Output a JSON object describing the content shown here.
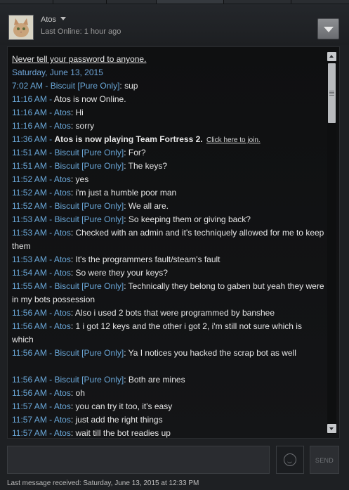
{
  "header": {
    "friend_name": "Atos",
    "last_online": "Last Online: 1 hour ago"
  },
  "chat": {
    "warning": "Never tell your password to anyone.",
    "date": "Saturday, June 13, 2015",
    "messages": [
      {
        "ts": "7:02 AM",
        "sender": "Biscuit [Pure Only]",
        "text": "sup"
      },
      {
        "ts": "11:16 AM",
        "sender": "",
        "text": "Atos is now Online."
      },
      {
        "ts": "11:16 AM",
        "sender": "Atos",
        "text": "Hi"
      },
      {
        "ts": "11:16 AM",
        "sender": "Atos",
        "text": "sorry"
      },
      {
        "ts": "11:36 AM",
        "sender": "",
        "text": "Atos is now playing Team Fortress 2.",
        "link": "Click here to join."
      },
      {
        "ts": "11:51 AM",
        "sender": "Biscuit [Pure Only]",
        "text": "For?"
      },
      {
        "ts": "11:51 AM",
        "sender": "Biscuit [Pure Only]",
        "text": "The keys?"
      },
      {
        "ts": "11:52 AM",
        "sender": "Atos",
        "text": "yes"
      },
      {
        "ts": "11:52 AM",
        "sender": "Atos",
        "text": "i'm just a humble poor man"
      },
      {
        "ts": "11:52 AM",
        "sender": "Biscuit [Pure Only]",
        "text": "We all are."
      },
      {
        "ts": "11:53 AM",
        "sender": "Biscuit [Pure Only]",
        "text": "So keeping them or giving back?"
      },
      {
        "ts": "11:53 AM",
        "sender": "Atos",
        "text": "Checked with an admin and it's techniquely allowed for me to keep them"
      },
      {
        "ts": "11:53 AM",
        "sender": "Atos",
        "text": "It's the programmers fault/steam's fault"
      },
      {
        "ts": "11:54 AM",
        "sender": "Atos",
        "text": "So were they your keys?"
      },
      {
        "ts": "11:55 AM",
        "sender": "Biscuit [Pure Only]",
        "text": "Technically they belong to gaben but yeah they were in my bots possession"
      },
      {
        "ts": "11:56 AM",
        "sender": "Atos",
        "text": "Also i used 2 bots that were programmed by banshee"
      },
      {
        "ts": "11:56 AM",
        "sender": "Atos",
        "text": "1 i got 12 keys and the other i got 2, i'm still not sure which is which"
      },
      {
        "ts": "11:56 AM",
        "sender": "Biscuit [Pure Only]",
        "text": "Ya I notices you hacked the scrap bot as well"
      },
      {
        "ts": "11:56 AM",
        "sender": "Biscuit [Pure Only]",
        "text": "Both are mines"
      },
      {
        "ts": "11:56 AM",
        "sender": "Atos",
        "text": "oh"
      },
      {
        "ts": "11:57 AM",
        "sender": "Atos",
        "text": "you can try it too, it's easy"
      },
      {
        "ts": "11:57 AM",
        "sender": "Atos",
        "text": "just add the right things"
      },
      {
        "ts": "11:57 AM",
        "sender": "Atos",
        "text": "wait till the bot readies up"
      }
    ]
  },
  "composer": {
    "send_label": "SEND"
  },
  "footer": {
    "last_received": "Last message received: Saturday, June 13, 2015 at 12:33 PM"
  },
  "icons": {
    "menu": "chevron-down-icon",
    "emoji": "smiley-icon"
  },
  "colors": {
    "timestamp": "#6aa7d8",
    "text": "#e6e6e6",
    "background": "#1e2023"
  }
}
